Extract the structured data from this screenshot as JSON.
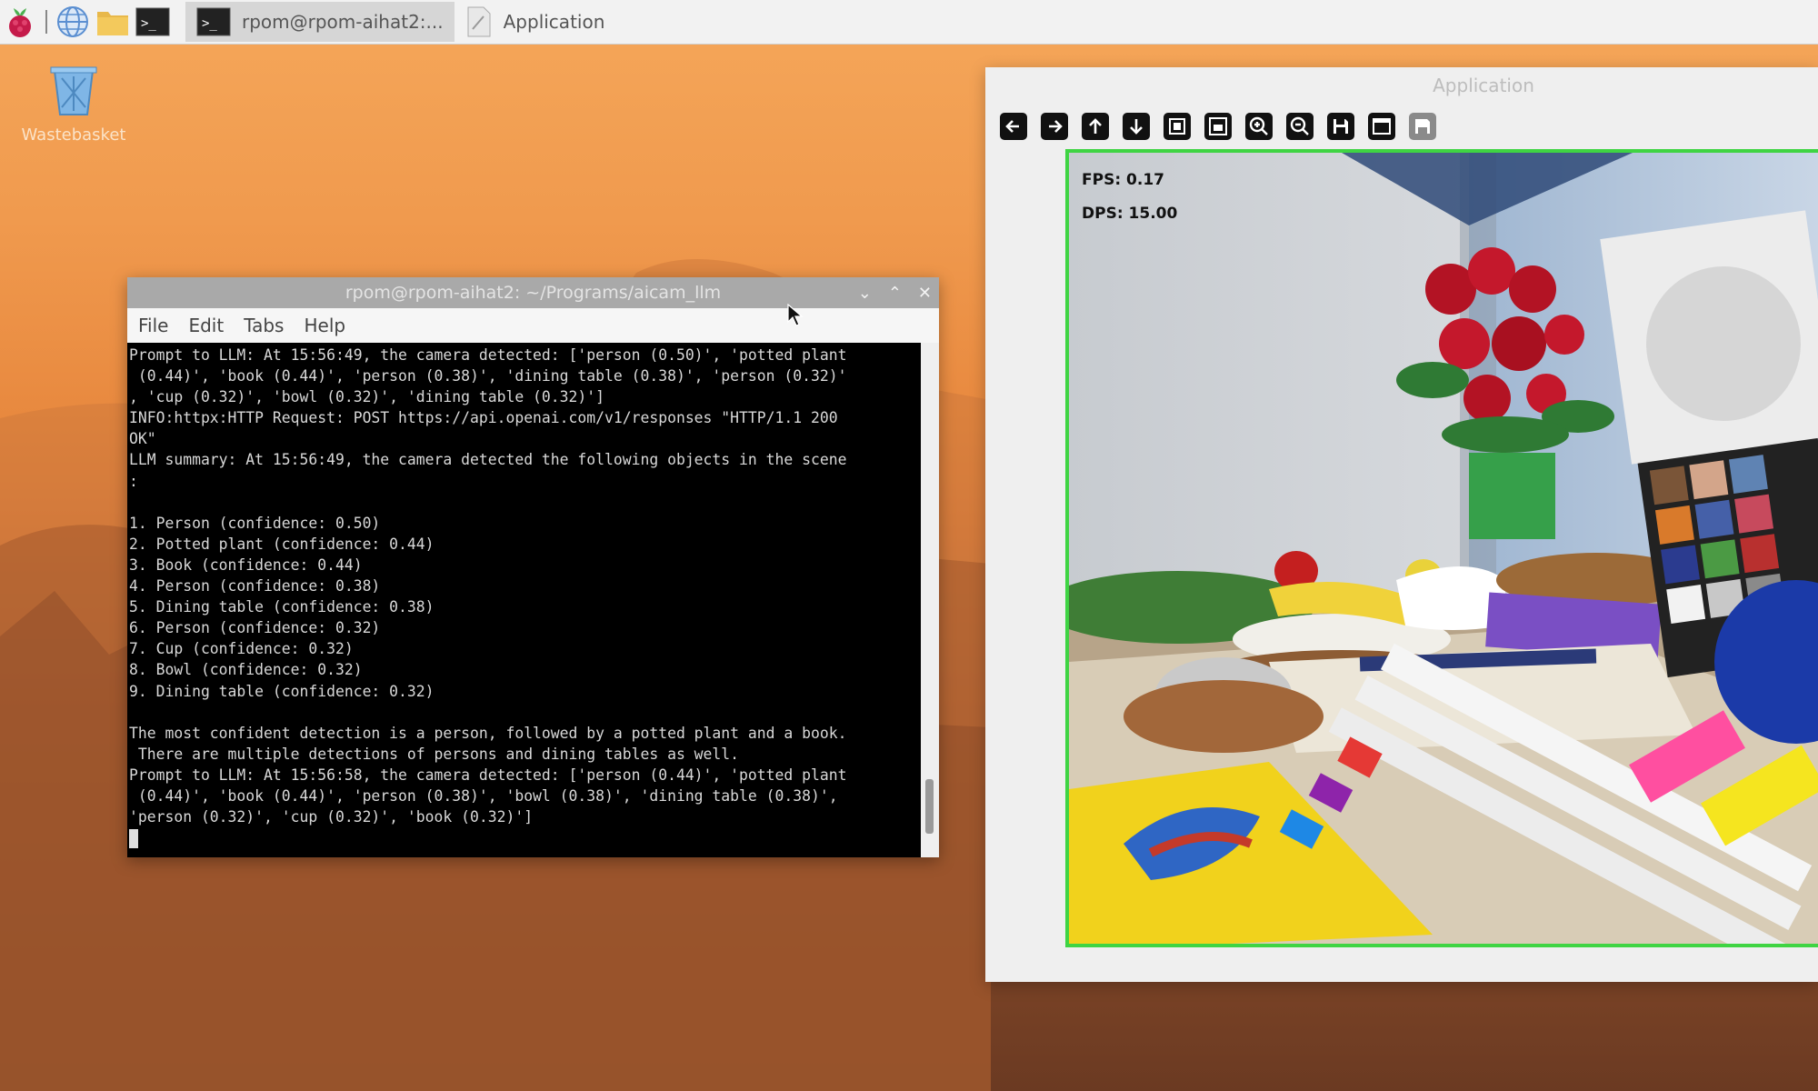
{
  "taskbar": {
    "tasks": [
      {
        "label": "rpom@rpom-aihat2:..."
      },
      {
        "label": "Application"
      }
    ]
  },
  "desktop": {
    "wastebasket_label": "Wastebasket"
  },
  "terminal": {
    "title": "rpom@rpom-aihat2: ~/Programs/aicam_llm",
    "menu": [
      "File",
      "Edit",
      "Tabs",
      "Help"
    ],
    "lines": [
      "Prompt to LLM: At 15:56:49, the camera detected: ['person (0.50)', 'potted plant",
      " (0.44)', 'book (0.44)', 'person (0.38)', 'dining table (0.38)', 'person (0.32)'",
      ", 'cup (0.32)', 'bowl (0.32)', 'dining table (0.32)']",
      "INFO:httpx:HTTP Request: POST https://api.openai.com/v1/responses \"HTTP/1.1 200",
      "OK\"",
      "LLM summary: At 15:56:49, the camera detected the following objects in the scene",
      ":",
      "",
      "1. Person (confidence: 0.50)",
      "2. Potted plant (confidence: 0.44)",
      "3. Book (confidence: 0.44)",
      "4. Person (confidence: 0.38)",
      "5. Dining table (confidence: 0.38)",
      "6. Person (confidence: 0.32)",
      "7. Cup (confidence: 0.32)",
      "8. Bowl (confidence: 0.32)",
      "9. Dining table (confidence: 0.32)",
      "",
      "The most confident detection is a person, followed by a potted plant and a book.",
      " There are multiple detections of persons and dining tables as well.",
      "Prompt to LLM: At 15:56:58, the camera detected: ['person (0.44)', 'potted plant",
      " (0.44)', 'book (0.44)', 'person (0.38)', 'bowl (0.38)', 'dining table (0.38)',",
      "'person (0.32)', 'cup (0.32)', 'book (0.32)']"
    ]
  },
  "app": {
    "title": "Application",
    "toolbar": [
      "arrow-left-icon",
      "arrow-right-icon",
      "arrow-up-icon",
      "arrow-down-icon",
      "zoom-rect-icon",
      "crop-icon",
      "zoom-in-icon",
      "zoom-out-icon",
      "save-icon",
      "window-icon",
      "save-alt-icon"
    ],
    "fps": "FPS: 0.17",
    "dps": "DPS: 15.00",
    "box_color": "#3fd443"
  }
}
